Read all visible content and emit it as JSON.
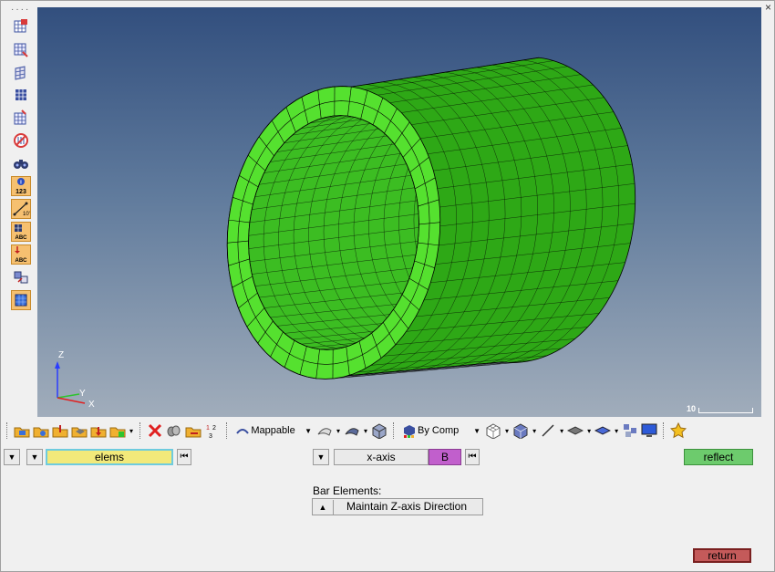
{
  "window": {
    "close_glyph": "×"
  },
  "left_toolbar": {
    "icons": [
      "mesh-check-icon",
      "mesh-edit-icon",
      "mesh-create-icon",
      "grid-icon",
      "mesh-split-icon",
      "no-mesh-icon",
      "binoculars-icon",
      "info-123-icon",
      "measure-icon",
      "label-abc-icon",
      "label-abc-down-icon",
      "transform-icon",
      "select-icon"
    ]
  },
  "viewport": {
    "scale_label": "10",
    "triad": {
      "z": "Z",
      "y": "Y",
      "x": "X"
    },
    "colors": {
      "mesh_face": "#55e12f",
      "mesh_outer": "#2ea816",
      "mesh_inner": "#3cbd22",
      "mesh_line": "#000000",
      "bg_top": "#324f7e",
      "bg_bottom": "#a1adbb"
    }
  },
  "bottom_toolbar": {
    "mesh_mode": "Mappable",
    "color_mode": "By Comp"
  },
  "panel": {
    "elems_label": "elems",
    "axis_label": "x-axis",
    "b_label": "B",
    "reflect_label": "reflect",
    "bar_elements_label": "Bar Elements:",
    "maintain_label": "Maintain Z-axis Direction",
    "return_label": "return"
  }
}
